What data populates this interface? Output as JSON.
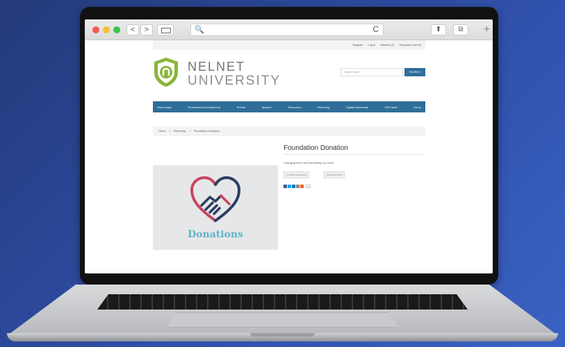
{
  "browser": {
    "search_glyph": "🔍",
    "reload_glyph": "C",
    "back_glyph": "<",
    "forward_glyph": ">",
    "share_glyph": "⬆",
    "tabs_glyph": "⧉",
    "plus_glyph": "+"
  },
  "topbar": {
    "links": [
      "Register",
      "Log in",
      "Wishlist (0)",
      "Shopping Cart (0)"
    ]
  },
  "brand": {
    "line1": "NELNET",
    "line2": "UNIVERSITY",
    "shield_color": "#8ab53a"
  },
  "search": {
    "placeholder": "Search store",
    "button_label": "SEARCH"
  },
  "nav": {
    "items": [
      "Home page",
      "Professional Development",
      "Events",
      "Apparel",
      "Resources",
      "Recurring",
      "Digital Downloads",
      "Gift Cards",
      "Demo"
    ],
    "color": "#2e6e98"
  },
  "breadcrumb": {
    "home": "Home",
    "category": "Recurring",
    "current": "Foundation Donation",
    "separator": "/"
  },
  "product": {
    "title": "Foundation Donation",
    "short_description": "Changing lives one scholarship at a time.",
    "image_caption": "Donations",
    "add_to_compare": "Add to compare list",
    "email_friend": "Email a friend",
    "share_count": "0"
  }
}
